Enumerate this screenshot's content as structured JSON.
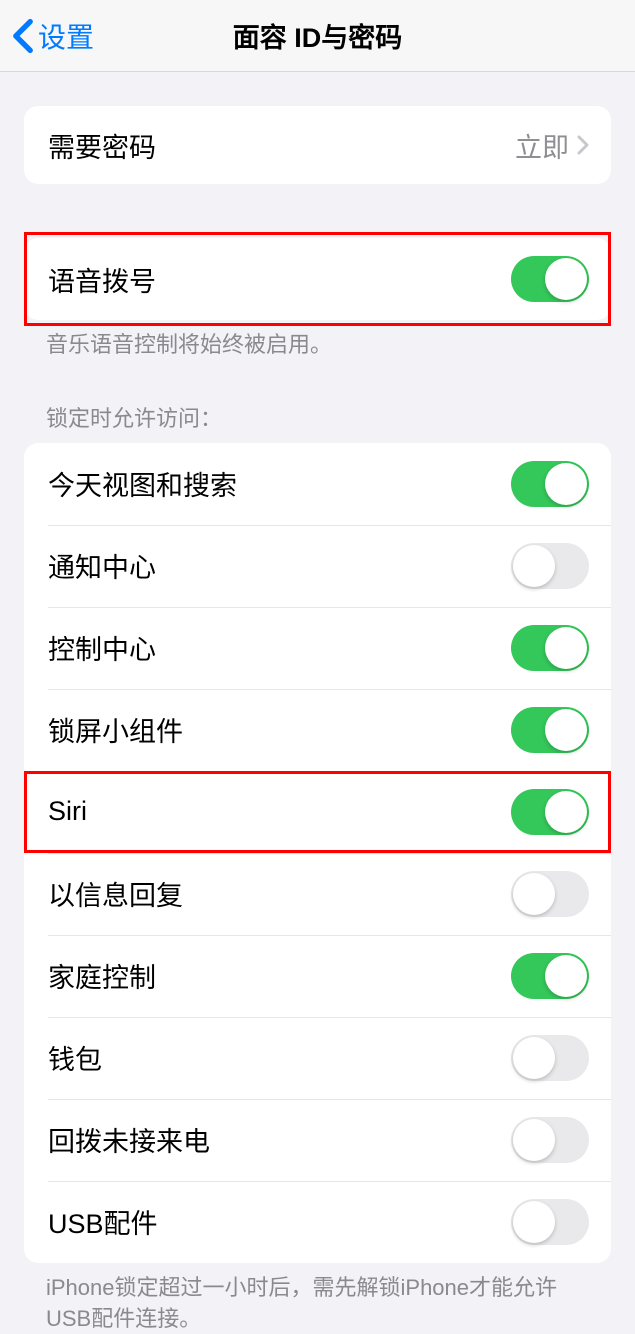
{
  "header": {
    "back_label": "设置",
    "title": "面容 ID与密码"
  },
  "require_passcode": {
    "label": "需要密码",
    "value": "立即"
  },
  "voice_dial": {
    "label": "语音拨号",
    "enabled": true,
    "footer": "音乐语音控制将始终被启用。"
  },
  "lock_access": {
    "header": "锁定时允许访问：",
    "items": [
      {
        "label": "今天视图和搜索",
        "enabled": true
      },
      {
        "label": "通知中心",
        "enabled": false
      },
      {
        "label": "控制中心",
        "enabled": true
      },
      {
        "label": "锁屏小组件",
        "enabled": true
      },
      {
        "label": "Siri",
        "enabled": true
      },
      {
        "label": "以信息回复",
        "enabled": false
      },
      {
        "label": "家庭控制",
        "enabled": true
      },
      {
        "label": "钱包",
        "enabled": false
      },
      {
        "label": "回拨未接来电",
        "enabled": false
      },
      {
        "label": "USB配件",
        "enabled": false
      }
    ],
    "footer": "iPhone锁定超过一小时后，需先解锁iPhone才能允许USB配件连接。"
  }
}
